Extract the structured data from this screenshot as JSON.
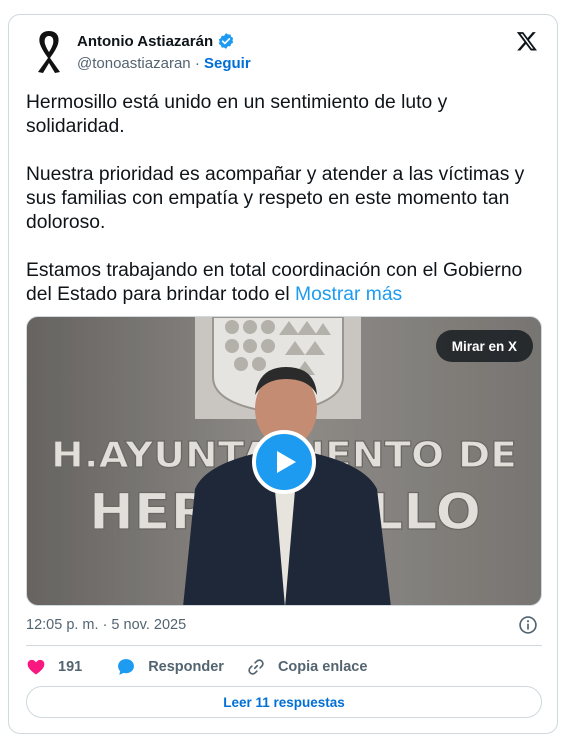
{
  "author": {
    "name": "Antonio Astiazarán",
    "handle": "@tonoastiazaran",
    "separator": "·",
    "follow_label": "Seguir",
    "verified_color": "#1d9bf0"
  },
  "tweet": {
    "text": "Hermosillo está unido en un sentimiento de luto y solidaridad.\n\nNuestra prioridad es acompañar y atender a las víctimas y sus familias con empatía y respeto en este momento tan doloroso.\n\nEstamos trabajando en total coordinación con el Gobierno del Estado para brindar todo el ",
    "show_more_label": "Mostrar más"
  },
  "media": {
    "watch_label": "Mirar en X",
    "wall_sign": {
      "line1": "H.AYUNTAMIENTO DE",
      "line2": "HERMOSILLO"
    }
  },
  "timestamp": "12:05 p. m. · 5 nov. 2025",
  "actions": {
    "like_count": "191",
    "reply_label": "Responder",
    "copy_link_label": "Copia enlace"
  },
  "read_replies_label": "Leer 11 respuestas",
  "colors": {
    "accent": "#1d9bf0",
    "like": "#f91880",
    "link": "#006fd6",
    "muted": "#536471"
  },
  "icons": [
    "mourning-ribbon-icon",
    "verified-badge-icon",
    "x-logo-icon",
    "play-icon",
    "info-icon",
    "heart-icon",
    "reply-bubble-icon",
    "link-icon"
  ]
}
